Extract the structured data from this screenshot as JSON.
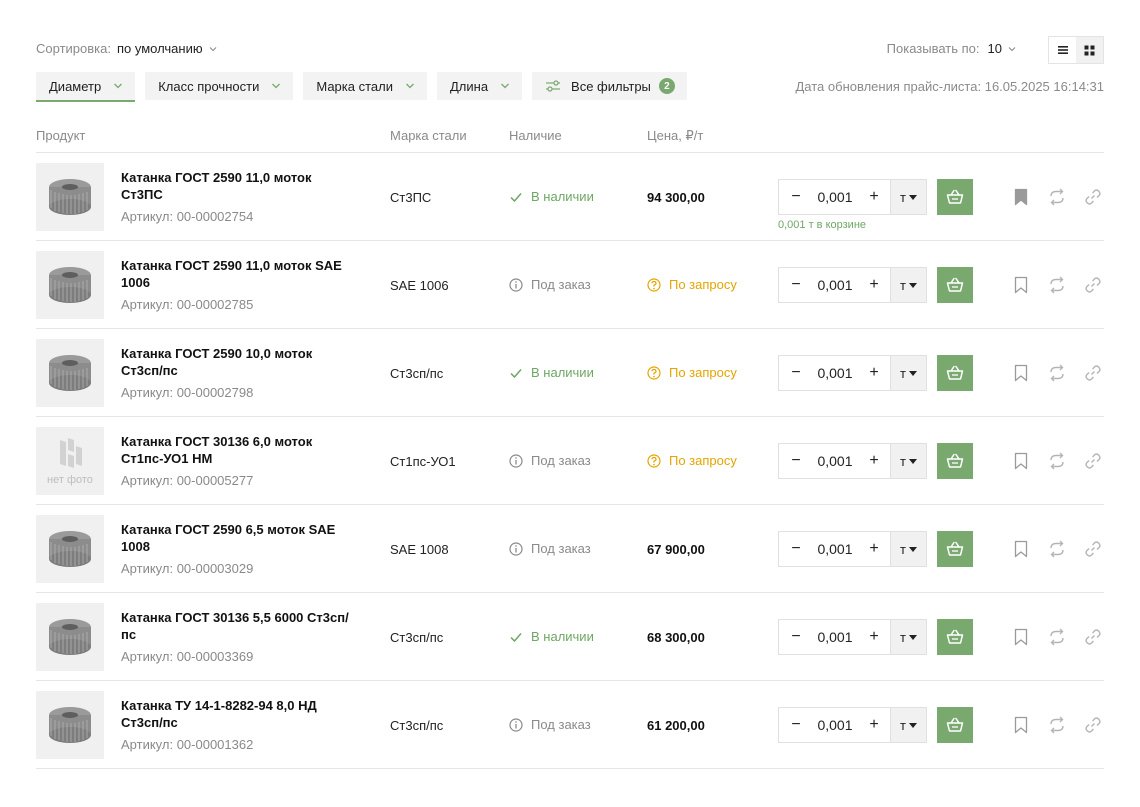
{
  "sort": {
    "label": "Сортировка:",
    "value": "по умолчанию"
  },
  "show": {
    "label": "Показывать по:",
    "value": "10"
  },
  "filters": [
    {
      "label": "Диаметр"
    },
    {
      "label": "Класс прочности"
    },
    {
      "label": "Марка стали"
    },
    {
      "label": "Длина"
    }
  ],
  "all_filters": {
    "label": "Все фильтры",
    "count": "2"
  },
  "updated": {
    "label": "Дата обновления прайс-листа:",
    "value": "16.05.2025 16:14:31"
  },
  "columns": {
    "product": "Продукт",
    "grade": "Марка стали",
    "availability": "Наличие",
    "price": "Цена, ₽/т"
  },
  "nophoto_label": "нет фото",
  "sku_label": "Артикул:",
  "accent_color": "#79a96f",
  "request_color": "#e6a400",
  "rows": [
    {
      "name": "Катанка ГОСТ 2590 11,0 моток Ст3ПС",
      "sku": "00-00002754",
      "grade": "Ст3ПС",
      "availability": "В наличии",
      "avail_type": "instock",
      "price": "94 300,00",
      "price_type": "value",
      "qty": "0,001",
      "unit": "т",
      "in_cart": "0,001 т в корзине",
      "bookmarked": true,
      "photo": true
    },
    {
      "name": "Катанка ГОСТ 2590 11,0 моток SAE 1006",
      "sku": "00-00002785",
      "grade": "SAE 1006",
      "availability": "Под заказ",
      "avail_type": "order",
      "price": "По запросу",
      "price_type": "request",
      "qty": "0,001",
      "unit": "т",
      "in_cart": "",
      "bookmarked": false,
      "photo": true
    },
    {
      "name": "Катанка ГОСТ 2590 10,0 моток Ст3сп/пс",
      "sku": "00-00002798",
      "grade": "Ст3сп/пс",
      "availability": "В наличии",
      "avail_type": "instock",
      "price": "По запросу",
      "price_type": "request",
      "qty": "0,001",
      "unit": "т",
      "in_cart": "",
      "bookmarked": false,
      "photo": true
    },
    {
      "name": "Катанка ГОСТ 30136 6,0 моток Ст1пс-УО1 НМ",
      "sku": "00-00005277",
      "grade": "Ст1пс-УО1",
      "availability": "Под заказ",
      "avail_type": "order",
      "price": "По запросу",
      "price_type": "request",
      "qty": "0,001",
      "unit": "т",
      "in_cart": "",
      "bookmarked": false,
      "photo": false
    },
    {
      "name": "Катанка ГОСТ 2590 6,5 моток SAE 1008",
      "sku": "00-00003029",
      "grade": "SAE 1008",
      "availability": "Под заказ",
      "avail_type": "order",
      "price": "67 900,00",
      "price_type": "value",
      "qty": "0,001",
      "unit": "т",
      "in_cart": "",
      "bookmarked": false,
      "photo": true
    },
    {
      "name": "Катанка ГОСТ 30136 5,5 6000 Ст3сп/пс",
      "sku": "00-00003369",
      "grade": "Ст3сп/пс",
      "availability": "В наличии",
      "avail_type": "instock",
      "price": "68 300,00",
      "price_type": "value",
      "qty": "0,001",
      "unit": "т",
      "in_cart": "",
      "bookmarked": false,
      "photo": true
    },
    {
      "name": "Катанка ТУ 14-1-8282-94 8,0 НД Ст3сп/пс",
      "sku": "00-00001362",
      "grade": "Ст3сп/пс",
      "availability": "Под заказ",
      "avail_type": "order",
      "price": "61 200,00",
      "price_type": "value",
      "qty": "0,001",
      "unit": "т",
      "in_cart": "",
      "bookmarked": false,
      "photo": true
    }
  ]
}
